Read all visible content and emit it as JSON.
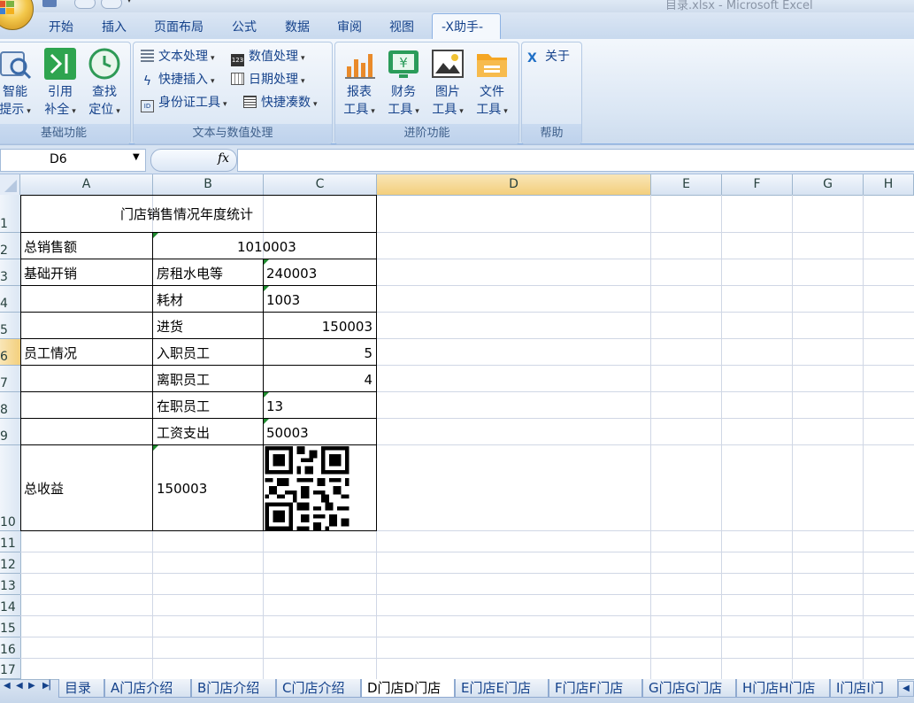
{
  "window": {
    "title": "目录.xlsx - Microsoft Excel"
  },
  "ribbon_tabs": [
    "开始",
    "插入",
    "页面布局",
    "公式",
    "数据",
    "审阅",
    "视图",
    "-X助手-"
  ],
  "groups": {
    "basic": {
      "title": "基础功能",
      "buttons": [
        {
          "line1": "智能",
          "line2": "提示",
          "icon": "magnifier-shapes-icon"
        },
        {
          "line1": "引用",
          "line2": "补全",
          "icon": "green-arrow-merge-icon"
        },
        {
          "line1": "查找",
          "line2": "定位",
          "icon": "target-clock-icon"
        }
      ]
    },
    "text_num": {
      "title": "文本与数值处理",
      "items": [
        {
          "label": "文本处理",
          "icon": "text-lines-icon"
        },
        {
          "label": "数值处理",
          "icon": "123-box-icon"
        },
        {
          "label": "快捷插入",
          "icon": "lightning-icon"
        },
        {
          "label": "日期处理",
          "icon": "calendar-icon"
        },
        {
          "label": "身份证工具",
          "icon": "id-card-icon"
        },
        {
          "label": "快捷凑数",
          "icon": "abacus-icon"
        }
      ]
    },
    "advanced": {
      "title": "进阶功能",
      "buttons": [
        {
          "line1": "报表",
          "line2": "工具",
          "icon": "bar-chart-icon"
        },
        {
          "line1": "财务",
          "line2": "工具",
          "icon": "yen-monitor-icon"
        },
        {
          "line1": "图片",
          "line2": "工具",
          "icon": "picture-icon"
        },
        {
          "line1": "文件",
          "line2": "工具",
          "icon": "folder-icon"
        }
      ]
    },
    "help": {
      "title": "帮助",
      "about": "关于",
      "icon": "x-logo-icon"
    }
  },
  "formula_bar": {
    "name_box": "D6",
    "fx": "fx",
    "formula": ""
  },
  "columns": [
    "A",
    "B",
    "C",
    "D",
    "E",
    "F",
    "G",
    "H"
  ],
  "rows": [
    "1",
    "2",
    "3",
    "4",
    "5",
    "6",
    "7",
    "8",
    "9",
    "10",
    "11",
    "12",
    "13",
    "14",
    "15",
    "16",
    "17"
  ],
  "cells": {
    "A1": "门店销售情况年度统计",
    "A2": "总销售额",
    "B2": "1010003",
    "A3": "基础开销",
    "B3": "房租水电等",
    "C3": "240003",
    "B4": "耗材",
    "C4": "1003",
    "B5": "进货",
    "C5": "150003",
    "A6": "员工情况",
    "B6": "入职员工",
    "C6": "5",
    "B7": "离职员工",
    "C7": "4",
    "B8": "在职员工",
    "C8": "13",
    "B9": "工资支出",
    "C9": "50003",
    "A10": "总收益",
    "B10": "150003"
  },
  "sheet_tabs": [
    "目录",
    "A门店介绍",
    "B门店介绍",
    "C门店介绍",
    "D门店D门店",
    "E门店E门店",
    "F门店F门店",
    "G门店G门店",
    "H门店H门店",
    "I门店I门"
  ],
  "active_sheet": "D门店D门店",
  "colors": {
    "ribbon_text": "#15428b",
    "green_mark": "#1e8a2e"
  }
}
